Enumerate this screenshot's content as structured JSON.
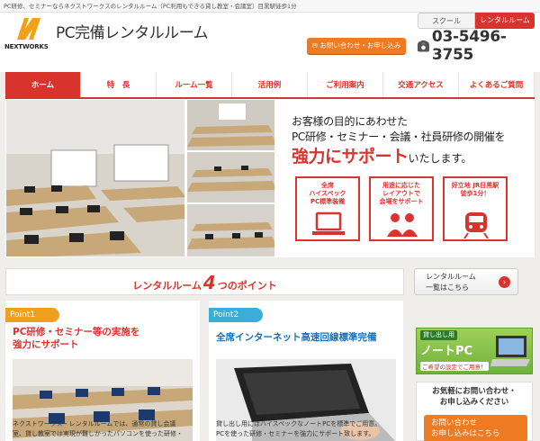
{
  "topbar": {
    "text": "PC研修、セミナーならネクストワークスのレンタルルーム（PC利用もできる貸し教室・会議室）目黒駅徒歩1分"
  },
  "header": {
    "logo_text": "NEXTWORKS",
    "site_title": "PC完備レンタルルーム",
    "tab_school": "スクール",
    "tab_rental": "レンタルルーム",
    "contact_label": "お問い合わせ・お申し込み",
    "phone": "03-5496-3755"
  },
  "nav": {
    "items": [
      "ホーム",
      "特　長",
      "ルーム一覧",
      "活用例",
      "ご利用案内",
      "交通アクセス",
      "よくあるご質問"
    ]
  },
  "hero": {
    "line1": "お客様の目的にあわせた",
    "line2": "PC研修・セミナー・会議・社員研修の開催を",
    "big": "強力にサポート",
    "tail": "いたします。",
    "features": [
      {
        "text": "全席\nハイスペック\nPC標準装備"
      },
      {
        "text": "用途に応じた\nレイアウトで\n会場をサポート"
      },
      {
        "text": "好立地 JR目黒駅\n徒歩1分！"
      }
    ]
  },
  "points_bar": {
    "prefix": "レンタルルーム",
    "number": "4",
    "suffix": "つのポイント"
  },
  "room_list_button": {
    "line1": "レンタルルーム",
    "line2": "一覧はこちら"
  },
  "cards": [
    {
      "tag": "Point1",
      "title1": "PC研修・セミナー等の実施を",
      "title2": "強力にサポート",
      "text1": "ネクストワークス・レンタルルームでは、通常の貸し会議",
      "text2": "室、貸し教室では実現が難しかったパソコンを使った研修・"
    },
    {
      "tag": "Point2",
      "title1": "全席インターネット高速回線標準完備",
      "title2": "",
      "text1": "貸し出し用にはハイスペックなノートPCを標準でご用意。",
      "text2": "PCを使った研修・セミナーを強力にサポート致します。"
    }
  ],
  "side": {
    "banner_tag": "貸し出し用",
    "banner_big": "ノートPC",
    "banner_sub": "ご希望の設定でご用意！",
    "inquiry_title1": "お気軽にお問い合わせ・",
    "inquiry_title2": "お申し込みください",
    "inquiry_btn1": "お問い合わせ",
    "inquiry_btn2": "お申し込みはこちら"
  },
  "colors": {
    "accent": "#d9332d",
    "orange": "#ee7a22",
    "point1": "#f0a020",
    "point2": "#3aaed8"
  }
}
